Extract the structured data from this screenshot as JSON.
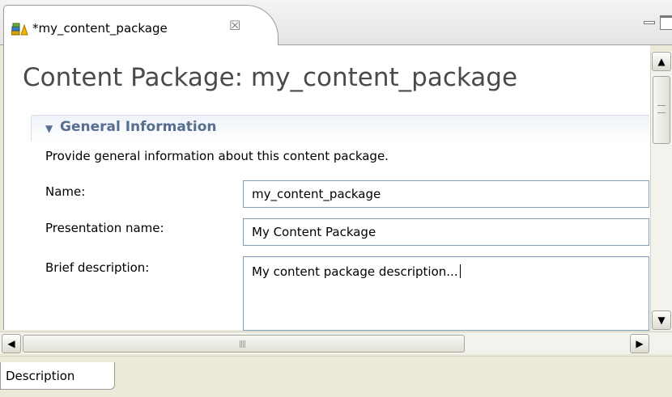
{
  "tab": {
    "title": "*my_content_package",
    "close_symbol": "☒",
    "icon": "content-package-icon"
  },
  "view": {
    "minimize_icon": "minimize-icon",
    "maximize_icon": "maximize-icon"
  },
  "page": {
    "title": "Content Package: my_content_package"
  },
  "section": {
    "toggle": "▼",
    "title": "General Information",
    "description": "Provide general information about this content package."
  },
  "form": {
    "name_label": "Name:",
    "name_value": "my_content_package",
    "presentation_label": "Presentation name:",
    "presentation_value": "My Content Package",
    "brief_label": "Brief description:",
    "brief_value": "My content package description..."
  },
  "scrollbars": {
    "up": "▲",
    "down": "▼",
    "left": "◀",
    "right": "▶",
    "h_grip": "||||"
  },
  "bottom_tabs": [
    {
      "label": "Description"
    }
  ],
  "colors": {
    "section_title": "#566e8f",
    "field_border": "#7f9db9",
    "page_title": "#4a4a4a"
  }
}
